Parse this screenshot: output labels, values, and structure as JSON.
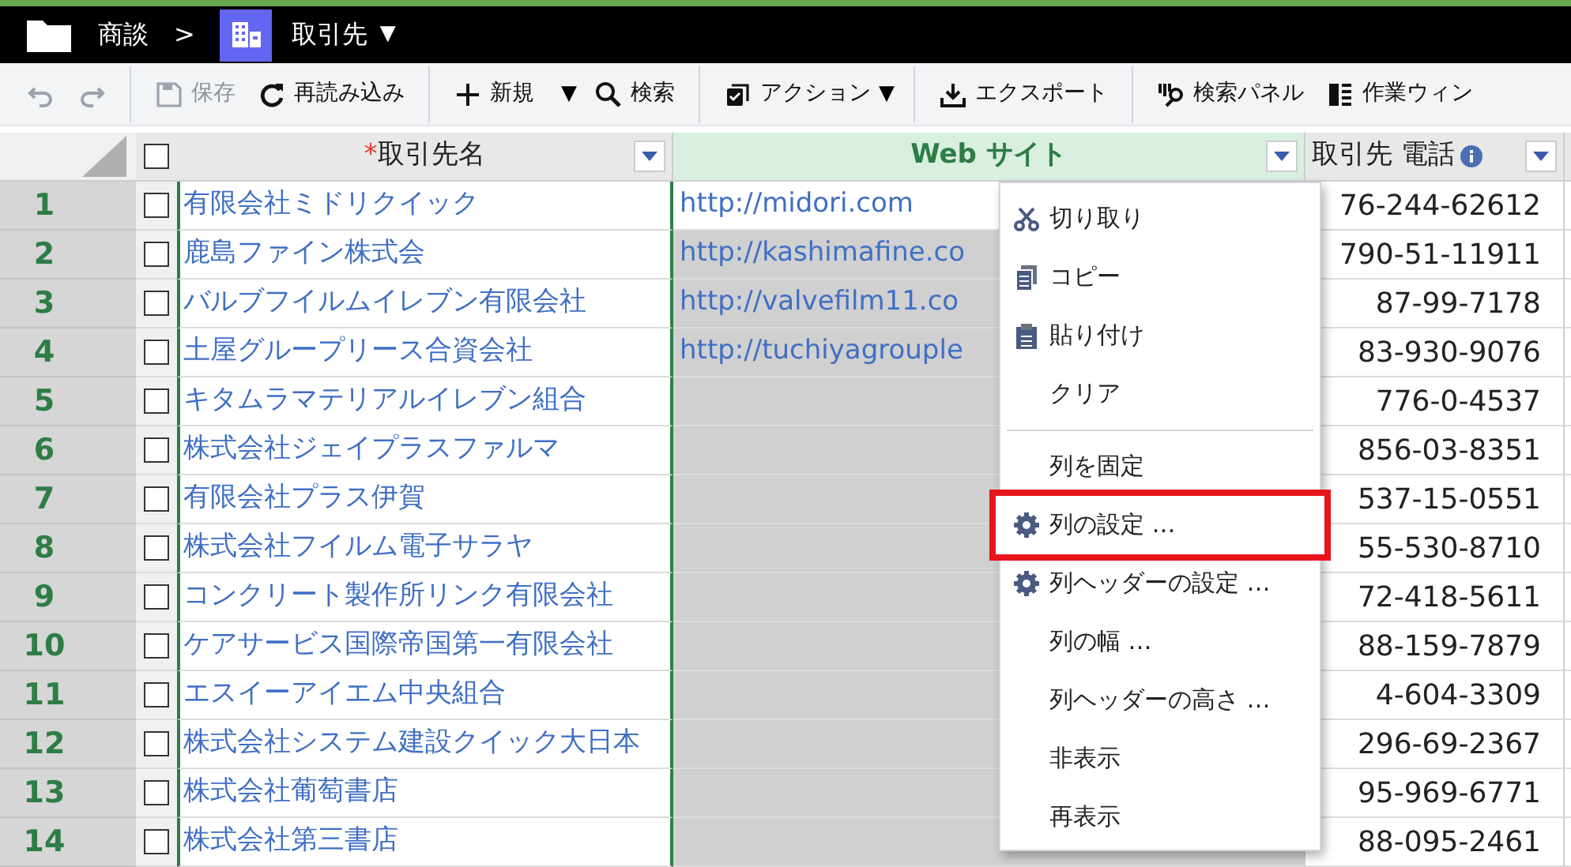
{
  "breadcrumb": {
    "parent": "商談",
    "separator": ">",
    "current": "取引先",
    "caret": "▼"
  },
  "toolbar": [
    {
      "kind": "undo",
      "disabled": true
    },
    {
      "kind": "redo",
      "disabled": true
    },
    {
      "kind": "sep"
    },
    {
      "kind": "save",
      "label": "保存",
      "disabled": true
    },
    {
      "kind": "reload",
      "label": "再読み込み",
      "disabled": false
    },
    {
      "kind": "sep"
    },
    {
      "kind": "new",
      "label": "新規",
      "disabled": false,
      "caret": "▼"
    },
    {
      "kind": "search",
      "label": "検索",
      "disabled": false
    },
    {
      "kind": "sep"
    },
    {
      "kind": "action",
      "label": "アクション",
      "disabled": false,
      "caret": "▼"
    },
    {
      "kind": "sep"
    },
    {
      "kind": "export",
      "label": "エクスポート",
      "disabled": false
    },
    {
      "kind": "sep"
    },
    {
      "kind": "panel",
      "label": "検索パネル",
      "disabled": false
    },
    {
      "kind": "work",
      "label": "作業ウィン",
      "disabled": false
    }
  ],
  "select_all": {
    "checked": false
  },
  "columns": [
    {
      "label": "取引先名",
      "required": "*",
      "selected": false,
      "info": false
    },
    {
      "label": "Web サイト",
      "selected": true,
      "info": false
    },
    {
      "label": "取引先 電話",
      "selected": false,
      "info": true
    }
  ],
  "rows": [
    {
      "number": "1",
      "checked": false,
      "name": "有限会社ミドリクイック",
      "web": "http://midori.com",
      "web_current": true,
      "phone": "76-244-62612"
    },
    {
      "number": "2",
      "checked": false,
      "name": "鹿島ファイン株式会",
      "web": "http://kashimafine.co",
      "web_current": false,
      "phone": "790-51-11911"
    },
    {
      "number": "3",
      "checked": false,
      "name": "バルブフイルムイレブン有限会社",
      "web": "http://valvefilm11.co",
      "web_current": false,
      "phone": "87-99-7178"
    },
    {
      "number": "4",
      "checked": false,
      "name": "土屋グループリース合資会社",
      "web": "http://tuchiyagrouple",
      "web_current": false,
      "phone": "83-930-9076"
    },
    {
      "number": "5",
      "checked": false,
      "name": "キタムラマテリアルイレブン組合",
      "web_current": false,
      "phone": "776-0-4537"
    },
    {
      "number": "6",
      "checked": false,
      "name": "株式会社ジェイプラスファルマ",
      "web_current": false,
      "phone": "856-03-8351"
    },
    {
      "number": "7",
      "checked": false,
      "name": "有限会社プラス伊賀",
      "web_current": false,
      "phone": "537-15-0551"
    },
    {
      "number": "8",
      "checked": false,
      "name": "株式会社フイルム電子サラヤ",
      "web_current": false,
      "phone": "55-530-8710"
    },
    {
      "number": "9",
      "checked": false,
      "name": "コンクリート製作所リンク有限会社",
      "web_current": false,
      "phone": "72-418-5611"
    },
    {
      "number": "10",
      "checked": false,
      "name": "ケアサービス国際帝国第一有限会社",
      "web_current": false,
      "phone": "88-159-7879"
    },
    {
      "number": "11",
      "checked": false,
      "name": "エスイーアイエム中央組合",
      "web_current": false,
      "phone": "4-604-3309"
    },
    {
      "number": "12",
      "checked": false,
      "name": "株式会社システム建設クイック大日本",
      "web_current": false,
      "phone": "296-69-2367"
    },
    {
      "number": "13",
      "checked": false,
      "name": "株式会社葡萄書店",
      "web_current": false,
      "phone": "95-969-6771"
    },
    {
      "number": "14",
      "checked": false,
      "name": "株式会社第三書店",
      "web_current": false,
      "phone": "88-095-2461"
    }
  ],
  "context_menu": [
    {
      "kind": "cut",
      "label": "切り取り",
      "selected": false
    },
    {
      "kind": "copy",
      "label": "コピー",
      "selected": false
    },
    {
      "kind": "paste",
      "label": "貼り付け",
      "selected": false
    },
    {
      "kind": "plain",
      "label": "クリア",
      "selected": false
    },
    {
      "kind": "divider"
    },
    {
      "kind": "plain",
      "label": "列を固定",
      "selected": false
    },
    {
      "kind": "gear",
      "label": "列の設定 …",
      "selected": true
    },
    {
      "kind": "gear",
      "label": "列ヘッダーの設定 …",
      "selected": false
    },
    {
      "kind": "plain",
      "label": "列の幅 …",
      "selected": false
    },
    {
      "kind": "plain",
      "label": "列ヘッダーの高さ …",
      "selected": false
    },
    {
      "kind": "plain",
      "label": "非表示",
      "selected": false
    },
    {
      "kind": "plain",
      "label": "再表示",
      "selected": false
    }
  ]
}
